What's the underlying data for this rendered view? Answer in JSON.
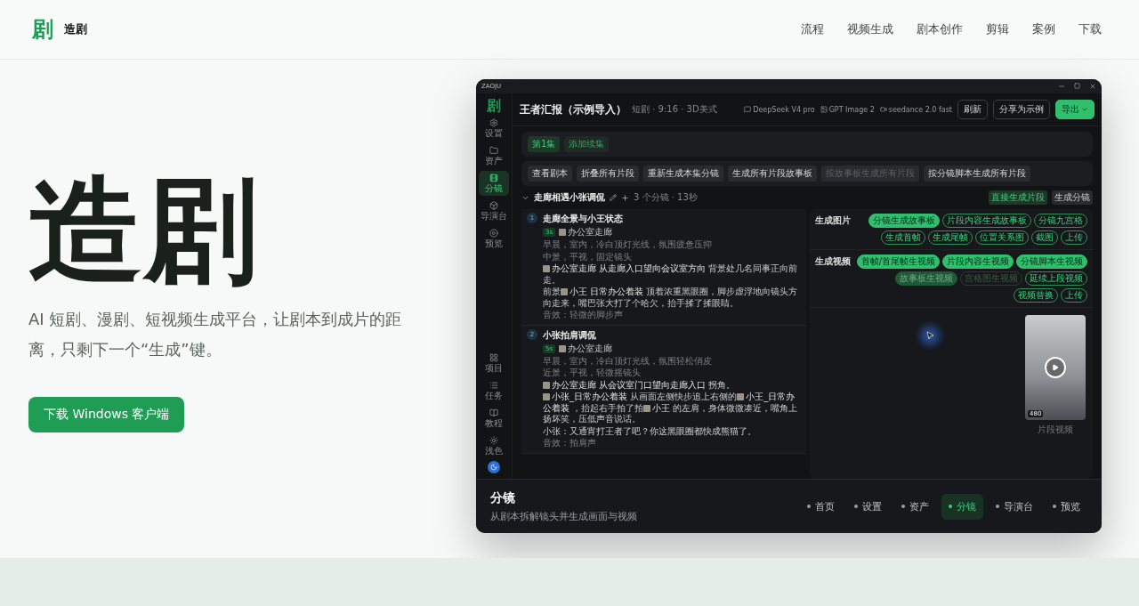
{
  "header": {
    "logo_mark": "剧",
    "brand": "造剧",
    "nav": [
      "流程",
      "视频生成",
      "剧本创作",
      "剪辑",
      "案例",
      "下载"
    ]
  },
  "hero": {
    "title": "造剧",
    "subtitle": "AI 短剧、漫剧、短视频生成平台，让剧本到成片的距离，只剩下一个“生成”键。",
    "cta": "下载 Windows 客户端"
  },
  "app": {
    "window_title": "ZAOJU",
    "logo_mark": "剧",
    "project_title": "王者汇报（示例导入）",
    "project_meta": "短剧 · 9:16 · 3D美式",
    "models": [
      {
        "kind": "text",
        "label": "DeepSeek V4 pro"
      },
      {
        "kind": "image",
        "label": "GPT Image 2"
      },
      {
        "kind": "video",
        "label": "seedance 2.0 fast"
      }
    ],
    "actions": [
      {
        "label": "刷新",
        "primary": false
      },
      {
        "label": "分享为示例",
        "primary": false
      },
      {
        "label": "导出",
        "primary": true
      }
    ],
    "sidebar": [
      {
        "label": "设置",
        "selected": false
      },
      {
        "label": "资产",
        "selected": false
      },
      {
        "label": "分镜",
        "selected": true
      },
      {
        "label": "导演台",
        "selected": false
      },
      {
        "label": "预览",
        "selected": false
      },
      {
        "label": "项目",
        "selected": false
      },
      {
        "label": "任务",
        "selected": false
      },
      {
        "label": "教程",
        "selected": false
      },
      {
        "label": "浅色",
        "selected": false
      }
    ],
    "episodes": [
      {
        "label": "第1集",
        "selected": true
      },
      {
        "label": "添加续集",
        "selected": false
      }
    ],
    "toolbar": [
      {
        "label": "查看剧本",
        "disabled": false
      },
      {
        "label": "折叠所有片段",
        "disabled": false
      },
      {
        "label": "重新生成本集分镜",
        "disabled": false
      },
      {
        "label": "生成所有片段故事板",
        "disabled": false
      },
      {
        "label": "按故事板生成所有片段",
        "disabled": true
      },
      {
        "label": "按分镜脚本生成所有片段",
        "disabled": false
      }
    ],
    "section": {
      "title": "走廊相遇小张调侃",
      "meta": "3 个分镜 · 13秒",
      "tags": [
        {
          "label": "直接生成片段",
          "selected": true
        },
        {
          "label": "生成分镜",
          "selected": false
        }
      ]
    },
    "shots": [
      {
        "number": "1",
        "title": "走廊全景与小王状态",
        "duration": "3s",
        "location": "办公室走廊",
        "lines": [
          {
            "kind": "muted",
            "parts": [
              {
                "text": "早晨，室内，冷白顶灯光线，氛围疲惫压抑"
              }
            ]
          },
          {
            "kind": "muted",
            "parts": [
              {
                "text": "中景，平视，固定镜头"
              }
            ]
          },
          {
            "kind": "action",
            "parts": [
              {
                "ref": "办公室走廊 从走廊入口望向会议室方向"
              },
              {
                "text": "背景处几名同事正向前走。"
              }
            ]
          },
          {
            "kind": "action",
            "parts": [
              {
                "text": "前景"
              },
              {
                "ref": "小王 日常办公着装"
              },
              {
                "text": "顶着浓重黑眼圈，脚步虚浮地向镜头方向走来，嘴巴张大打了个哈欠，抬手揉了揉眼睛。"
              }
            ]
          },
          {
            "kind": "muted",
            "parts": [
              {
                "text": "音效：轻微的脚步声"
              }
            ]
          }
        ]
      },
      {
        "number": "2",
        "title": "小张拍肩调侃",
        "duration": "5s",
        "location": "办公室走廊",
        "lines": [
          {
            "kind": "muted",
            "parts": [
              {
                "text": "早晨，室内，冷白顶灯光线，氛围轻松俏皮"
              }
            ]
          },
          {
            "kind": "muted",
            "parts": [
              {
                "text": "近景，平视，轻微摇镜头"
              }
            ]
          },
          {
            "kind": "action",
            "parts": [
              {
                "ref": "办公室走廊 从会议室门口望向走廊入口"
              },
              {
                "text": "拐角。"
              }
            ]
          },
          {
            "kind": "action",
            "parts": [
              {
                "ref": "小张_日常办公着装"
              },
              {
                "text": "从画面左侧快步追上右侧的"
              },
              {
                "ref": "小王_日常办公着装"
              },
              {
                "text": "，抬起右手拍了拍"
              },
              {
                "ref": "小王"
              },
              {
                "text": "的左肩，身体微微凑近，嘴角上扬坏笑，压低声音说话。"
              }
            ]
          },
          {
            "kind": "dialogue",
            "parts": [
              {
                "text": "小张：又通宵打王者了吧？你这黑眼圈都快成熊猫了。"
              }
            ]
          },
          {
            "kind": "muted",
            "parts": [
              {
                "text": "音效：拍肩声"
              }
            ]
          }
        ]
      }
    ],
    "generate": [
      {
        "label": "生成图片",
        "chips": [
          {
            "label": "分镜生成故事板",
            "kind": "filled"
          },
          {
            "label": "片段内容生成故事板",
            "kind": "outline"
          },
          {
            "label": "分镜九宫格",
            "kind": "outline"
          },
          {
            "label": "生成首帧",
            "kind": "outline"
          },
          {
            "label": "生成尾帧",
            "kind": "outline"
          },
          {
            "label": "位置关系图",
            "kind": "outline"
          },
          {
            "label": "截图",
            "kind": "outline"
          },
          {
            "label": "上传",
            "kind": "outline"
          }
        ]
      },
      {
        "label": "生成视频",
        "chips": [
          {
            "label": "首帧/首尾帧生视频",
            "kind": "filled"
          },
          {
            "label": "片段内容生视频",
            "kind": "filled"
          },
          {
            "label": "分镜脚本生视频",
            "kind": "filled"
          },
          {
            "label": "故事板生视频",
            "kind": "dim"
          },
          {
            "label": "宫格图生视频",
            "kind": "disabled"
          },
          {
            "label": "延续上段视频",
            "kind": "outline"
          },
          {
            "label": "视频替换",
            "kind": "outline"
          },
          {
            "label": "上传",
            "kind": "outline"
          }
        ]
      }
    ],
    "video": {
      "resolution": "480",
      "caption": "片段视频"
    },
    "footer": {
      "title": "分镜",
      "subtitle": "从剧本拆解镜头并生成画面与视频",
      "nav": [
        {
          "label": "首页",
          "selected": false
        },
        {
          "label": "设置",
          "selected": false
        },
        {
          "label": "资产",
          "selected": false
        },
        {
          "label": "分镜",
          "selected": true
        },
        {
          "label": "导演台",
          "selected": false
        },
        {
          "label": "预览",
          "selected": false
        }
      ]
    }
  }
}
